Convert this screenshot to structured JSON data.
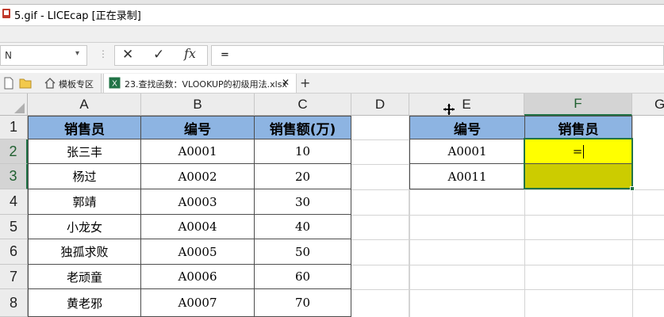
{
  "window": {
    "title": "5.gif - LICEcap [正在录制]"
  },
  "formula_bar": {
    "name_box": "N",
    "name_box_arrow": "▾",
    "separator": "⋮",
    "cancel_glyph": "✕",
    "confirm_glyph": "✓",
    "fx_glyph": "fx",
    "content": "="
  },
  "tabs": {
    "template_label": "模板专区",
    "active_label": "23.查找函数：VLOOKUP的初级用法.xlsx",
    "close_glyph": "✕",
    "add_glyph": "+"
  },
  "sheet": {
    "columns": [
      "A",
      "B",
      "C",
      "D",
      "E",
      "F",
      "G"
    ],
    "rows": [
      "1",
      "2",
      "3",
      "4",
      "5",
      "6",
      "7",
      "8"
    ],
    "selected_column": "F",
    "selected_rows": [
      "2",
      "3"
    ],
    "main_table": {
      "headers": [
        "销售员",
        "编号",
        "销售额(万)"
      ],
      "rows": [
        [
          "张三丰",
          "A0001",
          "10"
        ],
        [
          "杨过",
          "A0002",
          "20"
        ],
        [
          "郭靖",
          "A0003",
          "30"
        ],
        [
          "小龙女",
          "A0004",
          "40"
        ],
        [
          "独孤求败",
          "A0005",
          "50"
        ],
        [
          "老顽童",
          "A0006",
          "60"
        ],
        [
          "黄老邪",
          "A0007",
          "70"
        ]
      ]
    },
    "lookup_table": {
      "headers": [
        "编号",
        "销售员"
      ],
      "rows": [
        [
          "A0001",
          "="
        ],
        [
          "A0011",
          ""
        ]
      ]
    }
  },
  "colors": {
    "header_fill": "#8db4e2",
    "active_cell_fill": "#ffff00",
    "range_fill": "#cccc00",
    "selection_border": "#217346"
  }
}
